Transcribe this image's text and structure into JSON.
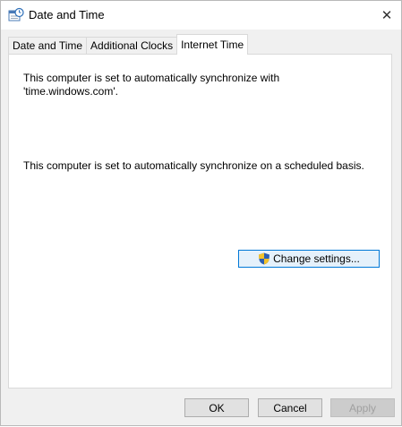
{
  "window": {
    "title": "Date and Time",
    "close_glyph": "✕"
  },
  "tabs": [
    {
      "label": "Date and Time",
      "active": false
    },
    {
      "label": "Additional Clocks",
      "active": false
    },
    {
      "label": "Internet Time",
      "active": true
    }
  ],
  "panel": {
    "message_sync_server": "This computer is set to automatically synchronize with 'time.windows.com'.",
    "message_schedule": "This computer is set to automatically synchronize on a scheduled basis.",
    "change_settings_label": "Change settings..."
  },
  "footer": {
    "ok_label": "OK",
    "cancel_label": "Cancel",
    "apply_label": "Apply",
    "apply_enabled": false
  },
  "icons": {
    "title": "clock-calendar-icon",
    "uac": "uac-shield-icon",
    "close": "close-icon",
    "cursor": "mouse-pointer-icon"
  },
  "colors": {
    "annotation_arrow": "#2b2a8c",
    "focus_border": "#0078d7"
  }
}
